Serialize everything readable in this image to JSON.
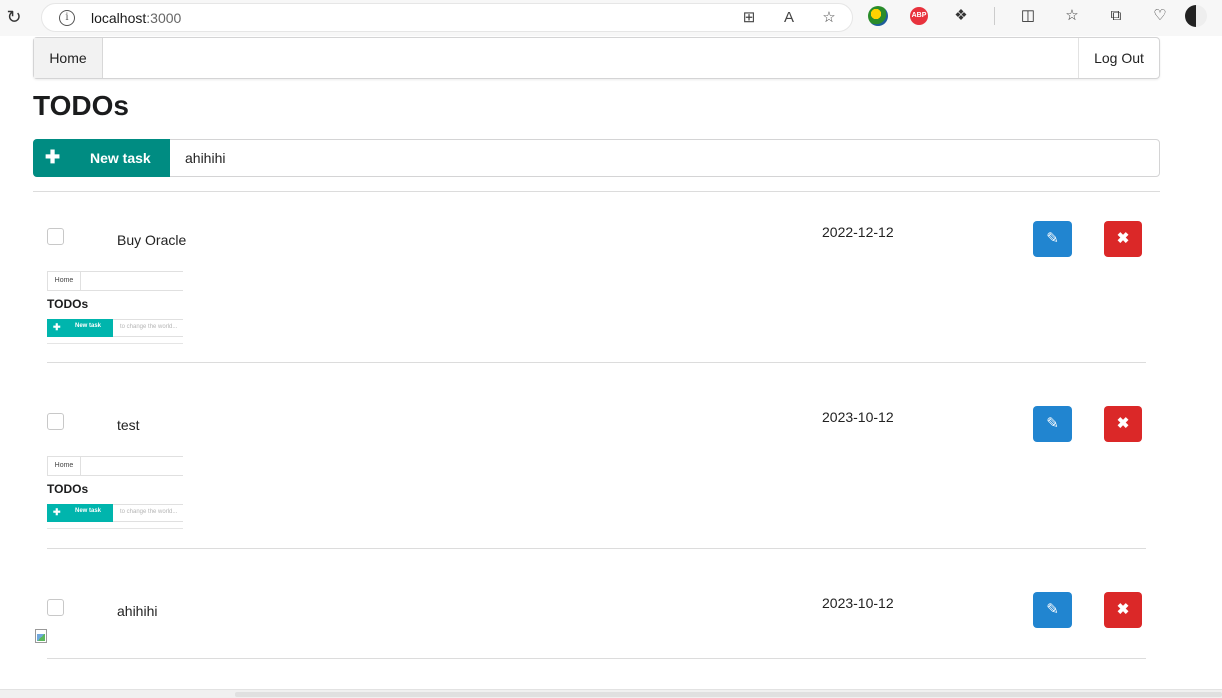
{
  "browser": {
    "url_host": "localhost",
    "url_rest": ":3000"
  },
  "navbar": {
    "home_label": "Home",
    "logout_label": "Log Out"
  },
  "page": {
    "title": "TODOs"
  },
  "task_bar": {
    "button_label": "New task",
    "input_value": "ahihihi"
  },
  "todos": [
    {
      "title": "Buy Oracle",
      "date": "2022-12-12",
      "thumbnail": "screenshot"
    },
    {
      "title": "test",
      "date": "2023-10-12",
      "thumbnail": "screenshot"
    },
    {
      "title": "ahihihi",
      "date": "2023-10-12",
      "thumbnail": "broken"
    }
  ],
  "thumbnail": {
    "home_label": "Home",
    "title": "TODOs",
    "button_label": "New task",
    "placeholder": "to change the world..."
  },
  "colors": {
    "new_task_button": "#008c82",
    "edit_button": "#2185d0",
    "delete_button": "#db2828"
  }
}
